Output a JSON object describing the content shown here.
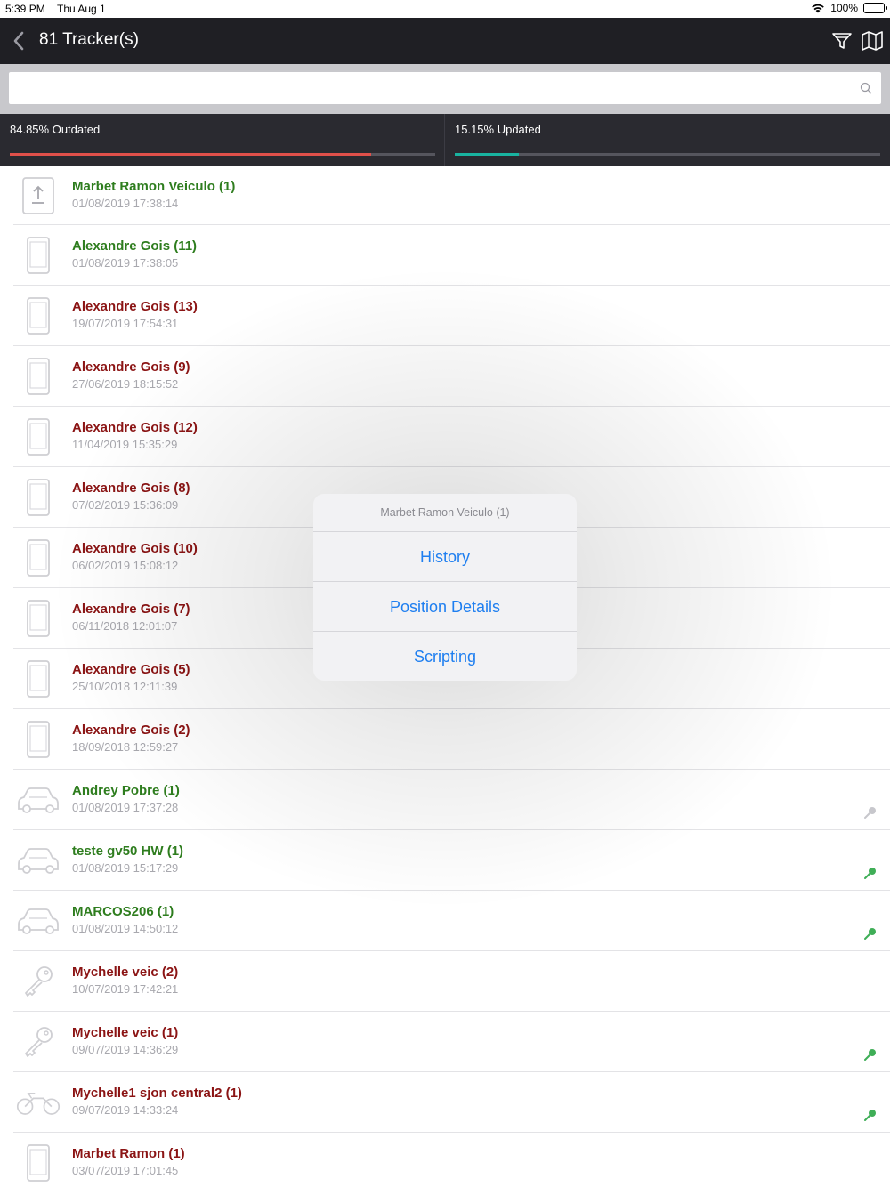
{
  "status_bar": {
    "time": "5:39 PM",
    "date": "Thu Aug 1",
    "battery": "100%"
  },
  "nav": {
    "title": "81 Tracker(s)"
  },
  "search": {
    "value": "",
    "placeholder": ""
  },
  "stats": {
    "outdated": {
      "label": "84.85% Outdated",
      "fraction": 0.8485,
      "color": "#e0504a"
    },
    "updated": {
      "label": "15.15% Updated",
      "fraction": 0.1515,
      "color": "#19b3a0"
    }
  },
  "colors": {
    "online": "#2e7d1e",
    "offline": "#8b1414",
    "accent": "#1f7ff0",
    "navbar": "#1f1f24"
  },
  "trackers": [
    {
      "name": "Marbet Ramon Veiculo (1)",
      "time": "01/08/2019 17:38:14",
      "status": "ok",
      "icon": "upload-device-icon",
      "pin": null
    },
    {
      "name": "Alexandre Gois (11)",
      "time": "01/08/2019 17:38:05",
      "status": "ok",
      "icon": "phone-icon",
      "pin": null
    },
    {
      "name": "Alexandre Gois (13)",
      "time": "19/07/2019 17:54:31",
      "status": "old",
      "icon": "phone-icon",
      "pin": null
    },
    {
      "name": "Alexandre Gois (9)",
      "time": "27/06/2019 18:15:52",
      "status": "old",
      "icon": "phone-icon",
      "pin": null
    },
    {
      "name": "Alexandre Gois (12)",
      "time": "11/04/2019 15:35:29",
      "status": "old",
      "icon": "phone-icon",
      "pin": null
    },
    {
      "name": "Alexandre Gois (8)",
      "time": "07/02/2019 15:36:09",
      "status": "old",
      "icon": "phone-icon",
      "pin": null
    },
    {
      "name": "Alexandre Gois (10)",
      "time": "06/02/2019 15:08:12",
      "status": "old",
      "icon": "phone-icon",
      "pin": null
    },
    {
      "name": "Alexandre Gois (7)",
      "time": "06/11/2018 12:01:07",
      "status": "old",
      "icon": "phone-icon",
      "pin": null
    },
    {
      "name": "Alexandre Gois (5)",
      "time": "25/10/2018 12:11:39",
      "status": "old",
      "icon": "phone-icon",
      "pin": null
    },
    {
      "name": "Alexandre Gois (2)",
      "time": "18/09/2018 12:59:27",
      "status": "old",
      "icon": "phone-icon",
      "pin": null
    },
    {
      "name": "Andrey Pobre (1)",
      "time": "01/08/2019 17:37:28",
      "status": "ok",
      "icon": "car-icon",
      "pin": "grey"
    },
    {
      "name": "teste gv50 HW (1)",
      "time": "01/08/2019 15:17:29",
      "status": "ok",
      "icon": "car-icon",
      "pin": "green"
    },
    {
      "name": "MARCOS206 (1)",
      "time": "01/08/2019 14:50:12",
      "status": "ok",
      "icon": "car-icon",
      "pin": "green"
    },
    {
      "name": "Mychelle veic (2)",
      "time": "10/07/2019 17:42:21",
      "status": "old",
      "icon": "key-icon",
      "pin": null
    },
    {
      "name": "Mychelle veic (1)",
      "time": "09/07/2019 14:36:29",
      "status": "old",
      "icon": "key-icon",
      "pin": "green"
    },
    {
      "name": "Mychelle1 sjon central2 (1)",
      "time": "09/07/2019 14:33:24",
      "status": "old",
      "icon": "motorcycle-icon",
      "pin": "green"
    },
    {
      "name": "Marbet Ramon (1)",
      "time": "03/07/2019 17:01:45",
      "status": "old",
      "icon": "phone-icon",
      "pin": null
    }
  ],
  "action_sheet": {
    "title": "Marbet Ramon Veiculo (1)",
    "actions": [
      "History",
      "Position Details",
      "Scripting"
    ]
  }
}
